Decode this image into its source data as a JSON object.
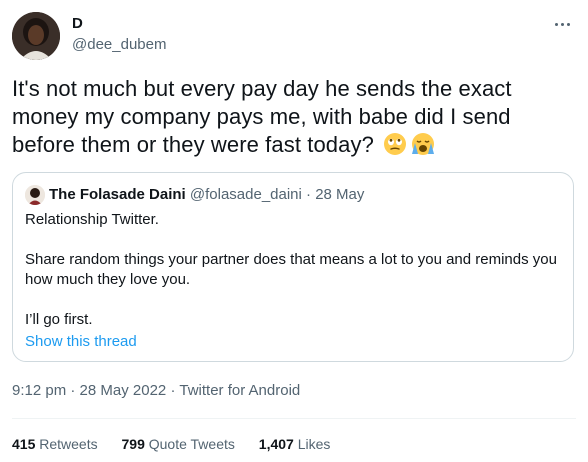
{
  "author": {
    "name": "D",
    "handle": "@dee_dubem"
  },
  "tweet": {
    "text": "It's not much but every pay day he  sends the exact money my company pays me, with babe did I send before them or they were fast today?",
    "emojis": [
      "face-with-rolling-eyes-emoji",
      "loudly-crying-face-emoji"
    ]
  },
  "quote": {
    "name": "The Folasade Daini",
    "handle": "@folasade_daini",
    "separator": "·",
    "date": "28 May",
    "line1": "Relationship Twitter.",
    "line2": "Share random things your partner does that means a lot to you and reminds you how much they love you.",
    "line3": "I’ll go first.",
    "show_thread": "Show this thread"
  },
  "meta": {
    "time": "9:12 pm",
    "date": "28 May 2022",
    "source": "Twitter for Android",
    "separator": "·"
  },
  "stats": {
    "retweets_count": "415",
    "retweets_label": "Retweets",
    "quotes_count": "799",
    "quotes_label": "Quote Tweets",
    "likes_count": "1,407",
    "likes_label": "Likes"
  },
  "colors": {
    "link": "#1d9bf0",
    "secondary_text": "#536471",
    "border": "#cfd9de"
  }
}
